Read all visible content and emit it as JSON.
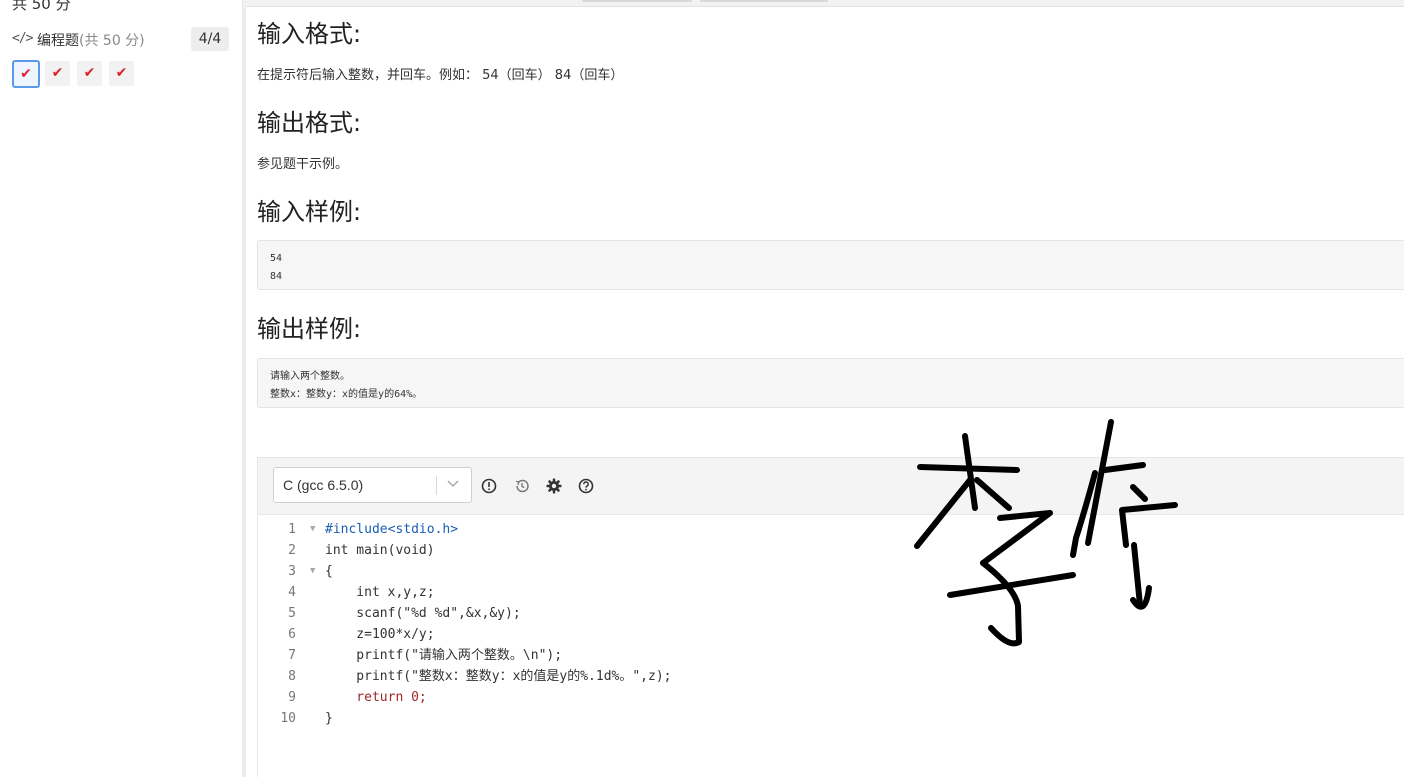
{
  "sidebar": {
    "total_score": "共 50 分",
    "section_icon": "code-icon",
    "section_title": "编程题",
    "section_subtitle": "(共 50 分)",
    "progress": "4/4",
    "questions": [
      {
        "status": "answered",
        "active": true
      },
      {
        "status": "answered",
        "active": false
      },
      {
        "status": "answered",
        "active": false
      },
      {
        "status": "answered",
        "active": false
      }
    ]
  },
  "problem": {
    "input_format_heading": "输入格式:",
    "input_format_text": "在提示符后输入整数，并回车。例如： 54（回车） 84（回车）",
    "output_format_heading": "输出格式:",
    "output_format_text": "参见题干示例。",
    "sample_input_heading": "输入样例:",
    "sample_input_lines": [
      "54",
      "84"
    ],
    "sample_output_heading": "输出样例:",
    "sample_output_lines": [
      "请输入两个整数。",
      "整数x：整数y：x的值是y的64%。"
    ]
  },
  "editor": {
    "language": "C (gcc 6.5.0)",
    "toolbar_icons": [
      "alert-circle-icon",
      "history-icon",
      "gear-icon",
      "help-circle-icon"
    ],
    "code": [
      {
        "n": "1",
        "text": "#include<stdio.h>"
      },
      {
        "n": "2",
        "text": "int main(void)"
      },
      {
        "n": "3",
        "text": "{"
      },
      {
        "n": "4",
        "text": "    int x,y,z;"
      },
      {
        "n": "5",
        "text": "    scanf(\"%d %d\",&x,&y);"
      },
      {
        "n": "6",
        "text": "    z=100*x/y;"
      },
      {
        "n": "7",
        "text": "    printf(\"请输入两个整数。\\n\");"
      },
      {
        "n": "8",
        "text": "    printf(\"整数x：整数y：x的值是y的%.1d%。\",z);"
      },
      {
        "n": "9",
        "text": "    return 0;"
      },
      {
        "n": "10",
        "text": "}"
      }
    ]
  },
  "signature": {
    "text": "李俐"
  },
  "colors": {
    "check": "#e0202a",
    "active_border": "#5b9ae8",
    "link_blue": "#1a5fb4"
  }
}
